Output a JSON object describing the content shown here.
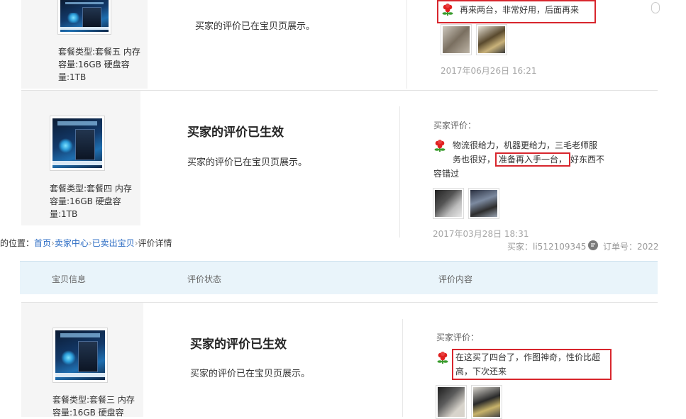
{
  "card1": {
    "spec_lines": [
      "套餐类型:套餐五  内存",
      "容量:16GB  硬盘容",
      "量:1TB"
    ],
    "status_text": "买家的评价已在宝贝页展示。",
    "review_text": "再来两台，非常好用，后面再来",
    "date": "2017年06月26日 16:21"
  },
  "card2": {
    "spec_lines": [
      "套餐类型:套餐四  内存",
      "容量:16GB  硬盘容",
      "量:1TB"
    ],
    "status_title": "买家的评价已生效",
    "status_text": "买家的评价已在宝贝页展示。",
    "review_label": "买家评价：",
    "review_line1": "物流很给力，机器更给力，三毛老师服",
    "review_line2_pre": "务也很好，",
    "review_line2_hl": "准备再入手一台，",
    "review_line2_post": "好东西不",
    "review_line3": "容错过",
    "date": "2017年03月28日 18:31",
    "buyer_label": "买家：",
    "buyer_id": "li512109345",
    "order_label": "订单号：2022"
  },
  "breadcrumb": {
    "prefix": "您的位置：",
    "items": [
      "首页",
      "卖家中心",
      "已卖出宝贝"
    ],
    "current": "评价详情",
    "sep": "›"
  },
  "table_header": {
    "col1": "宝贝信息",
    "col2": "评价状态",
    "col3": "评价内容"
  },
  "card3": {
    "spec_lines": [
      "套餐类型:套餐三  内存",
      "容量:16GB  硬盘容"
    ],
    "status_title": "买家的评价已生效",
    "status_text": "买家的评价已在宝贝页展示。",
    "review_label": "买家评价：",
    "review_line1": "在这买了四台了，作图神奇，性价比超",
    "review_line2": "高，下次还来"
  },
  "colors": {
    "highlight": "#d8262d",
    "link": "#2b6cc4",
    "header_bg": "#e9f4fa"
  },
  "icons": [
    "flower-icon",
    "speech-bubble-icon"
  ]
}
